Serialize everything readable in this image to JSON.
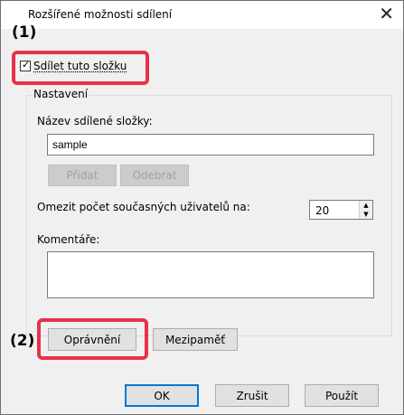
{
  "window": {
    "title": "Rozšířené možnosti sdílení",
    "close_glyph": "✕"
  },
  "callouts": {
    "one": "(1)",
    "two": "(2)"
  },
  "share_checkbox": {
    "label": "Sdílet tuto složku",
    "checked": true,
    "check_glyph": "✓"
  },
  "settings_group": {
    "legend": "Nastavení",
    "share_name_label": "Název sdílené složky:",
    "share_name_value": "sample",
    "add_button": "Přidat",
    "remove_button": "Odebrat",
    "limit_label": "Omezit počet současných uživatelů na:",
    "limit_value": "20",
    "spin_up_glyph": "▲",
    "spin_down_glyph": "▼",
    "comments_label": "Komentáře:",
    "comments_value": "",
    "permissions_button": "Oprávnění",
    "caching_button": "Mezipaměť"
  },
  "footer": {
    "ok_button": "OK",
    "cancel_button": "Zrušit",
    "apply_button": "Použít"
  },
  "colors": {
    "callout_red": "#e8314a",
    "dialog_bg": "#f0f0f0",
    "focus_blue": "#0078d7"
  }
}
